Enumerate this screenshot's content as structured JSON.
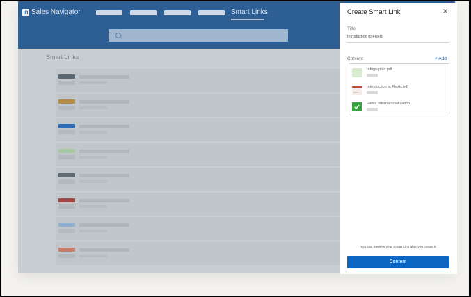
{
  "app": {
    "logo_mark": "in",
    "logo_text": "Sales Navigator",
    "nav_active": "Smart Links",
    "page_title": "Smart Links"
  },
  "colors": {
    "topbar": "#2d5f95",
    "accent": "#0a66c2"
  },
  "list_thumb_colors": [
    "#5b6670",
    "#b58b45",
    "#2c6db6",
    "#a8c6a3",
    "#5f6a73",
    "#9f4a44",
    "#8fb0d0",
    "#c47f6c"
  ],
  "panel": {
    "title": "Create Smart Link",
    "close_icon": "×",
    "title_label": "Title",
    "title_value": "Introduction to Flexis",
    "content_label": "Content",
    "add_label": "Add",
    "add_icon": "+",
    "content_items": [
      {
        "name": "Infographic.pdf",
        "icon": "image-thumbnail-icon",
        "color": "#d7ebce"
      },
      {
        "name": "Introduction to Flexis.pdf",
        "icon": "pdf-thumbnail-icon",
        "color": "#f1e4dd"
      },
      {
        "name": "Flexis Internationalization",
        "icon": "spreadsheet-icon",
        "color": "#36a33e"
      }
    ],
    "footer_note": "You can preview your Smart Link after you create it.",
    "primary_button": "Content"
  }
}
